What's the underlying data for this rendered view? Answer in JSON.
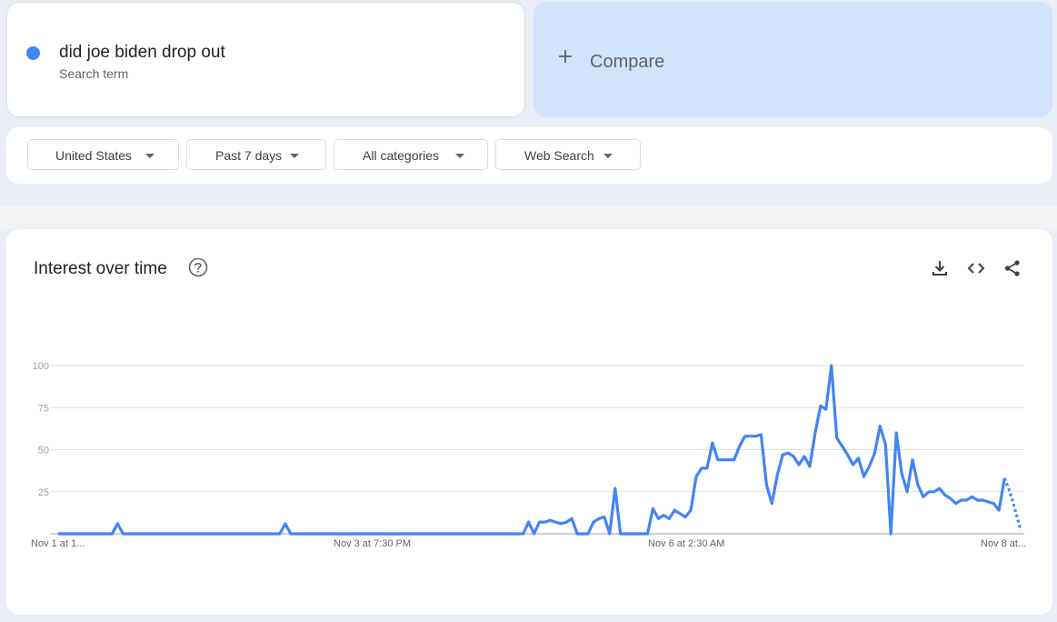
{
  "search_term": {
    "name": "did joe biden drop out",
    "type": "Search term",
    "color": "#4285f4"
  },
  "compare": {
    "label": "Compare"
  },
  "filters": [
    {
      "label": "United States"
    },
    {
      "label": "Past 7 days"
    },
    {
      "label": "All categories"
    },
    {
      "label": "Web Search"
    }
  ],
  "chart": {
    "title": "Interest over time"
  },
  "icons": {
    "help": "help-circle-icon",
    "download": "download-icon",
    "embed": "code-embed-icon",
    "share": "share-icon"
  },
  "chart_data": {
    "type": "line",
    "series": [
      {
        "values": [
          0,
          0,
          0,
          0,
          0,
          0,
          0,
          0,
          0,
          0,
          0,
          6,
          0,
          0,
          0,
          0,
          0,
          0,
          0,
          0,
          0,
          0,
          0,
          0,
          0,
          0,
          0,
          0,
          0,
          0,
          0,
          0,
          0,
          0,
          0,
          0,
          0,
          0,
          0,
          0,
          0,
          0,
          6,
          0,
          0,
          0,
          0,
          0,
          0,
          0,
          0,
          0,
          0,
          0,
          0,
          0,
          0,
          0,
          0,
          0,
          0,
          0,
          0,
          0,
          0,
          0,
          0,
          0,
          0,
          0,
          0,
          0,
          0,
          0,
          0,
          0,
          0,
          0,
          0,
          0,
          0,
          0,
          0,
          0,
          0,
          0,
          0,
          7,
          0,
          7,
          7,
          8,
          7,
          6,
          7,
          9,
          0,
          0,
          0,
          7,
          9,
          10,
          0,
          27,
          0,
          0,
          0,
          0,
          0,
          0,
          15,
          9,
          11,
          9,
          14,
          12,
          10,
          14,
          34,
          39,
          39,
          54,
          44,
          44,
          44,
          44,
          52,
          58,
          58,
          58,
          59,
          29,
          18,
          35,
          47,
          48,
          46,
          41,
          46,
          40,
          60,
          76,
          74,
          100,
          57,
          52,
          47,
          41,
          45,
          34,
          40,
          48,
          64,
          53,
          0,
          60,
          36,
          25,
          44,
          29,
          22,
          25,
          25,
          27,
          23,
          21,
          18,
          20,
          20,
          22,
          20,
          20,
          19,
          18,
          14,
          33,
          25,
          14,
          2
        ]
      }
    ],
    "x_ticks": [
      "Nov 1 at 1...",
      "Nov 3 at 7:30 PM",
      "Nov 6 at 2:30 AM",
      "Nov 8 at..."
    ],
    "y_ticks": [
      "25",
      "50",
      "75",
      "100"
    ],
    "ylim": [
      0,
      100
    ],
    "partial_last_points": 3,
    "grid": true,
    "line_color": "#4285f4"
  }
}
